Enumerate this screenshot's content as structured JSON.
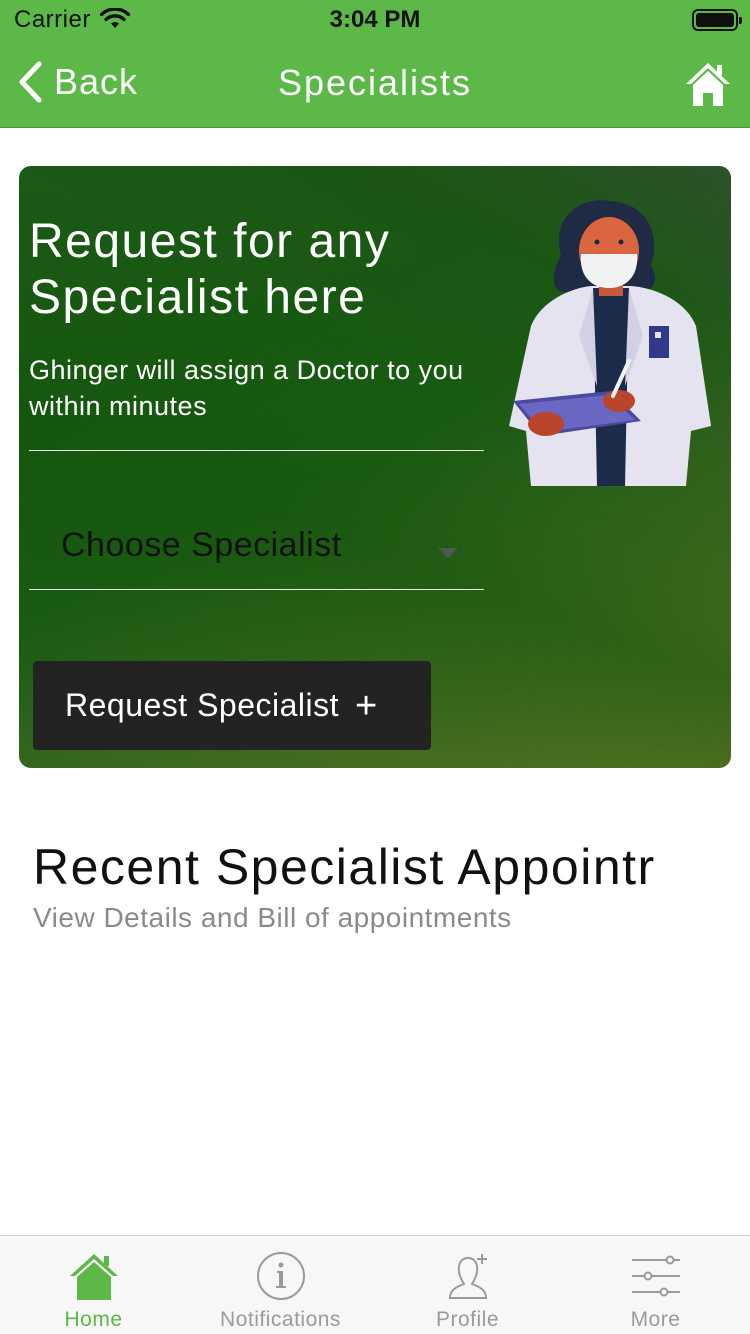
{
  "status_bar": {
    "carrier": "Carrier",
    "time": "3:04 PM"
  },
  "nav": {
    "back_label": "Back",
    "title": "Specialists",
    "home_icon": "home-icon"
  },
  "hero": {
    "title": "Request for any Specialist here",
    "subtitle": "Ghinger will assign a Doctor to you within minutes",
    "select_value": "Choose Specialist",
    "button_label": "Request Specialist",
    "button_plus": "+"
  },
  "recent": {
    "title": "Recent Specialist Appointr",
    "subtitle": "View Details and Bill of appointments"
  },
  "tabbar": {
    "items": [
      {
        "label": "Home",
        "icon": "home-icon",
        "active": true
      },
      {
        "label": "Notifications",
        "icon": "info-icon",
        "active": false
      },
      {
        "label": "Profile",
        "icon": "profile-add-icon",
        "active": false
      },
      {
        "label": "More",
        "icon": "sliders-icon",
        "active": false
      }
    ]
  },
  "colors": {
    "accent": "#5cb947",
    "button_dark": "#232323",
    "muted": "#8a8a8a"
  }
}
